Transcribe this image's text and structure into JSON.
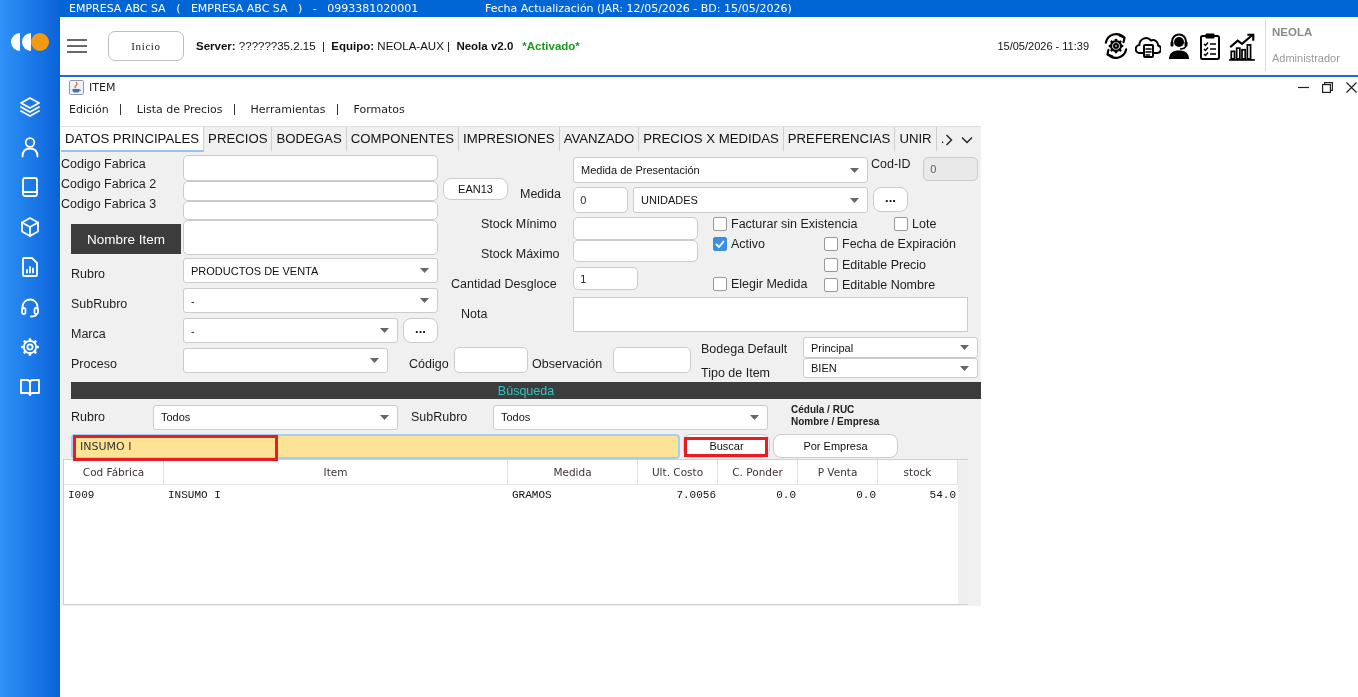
{
  "top_bar": {
    "company": "EMPRESA ABC SA   (   EMPRESA ABC SA   )   -   0993381020001",
    "update_info": "Fecha Actualización (JAR: 12/05/2026 - BD: 15/05/2026)"
  },
  "header": {
    "home_button": "Inicio",
    "connection_info": "**Server:** ??????35.2.15  |  **Equipo:** NEOLA-AUX |  **Neola v2.0**",
    "status": "*Activado*",
    "datetime": "15/05/2026 - 11:39",
    "user": {
      "name": "NEOLA",
      "role": "Administrador"
    }
  },
  "window": {
    "title": "ITEM"
  },
  "menu": [
    "Edición",
    "Lista de Precios",
    "Herramientas",
    "Formatos"
  ],
  "tabs": [
    {
      "label": "DATOS PRINCIPALES",
      "selected": true
    },
    {
      "label": "PRECIOS",
      "selected": false
    },
    {
      "label": "BODEGAS",
      "selected": false
    },
    {
      "label": "COMPONENTES",
      "selected": false
    },
    {
      "label": "IMPRESIONES",
      "selected": false
    },
    {
      "label": "AVANZADO",
      "selected": false
    },
    {
      "label": "PRECIOS X MEDIDAS",
      "selected": false
    },
    {
      "label": "PREFERENCIAS",
      "selected": false
    },
    {
      "label": "UNIR",
      "selected": false
    },
    {
      "label": ".",
      "selected": false
    }
  ],
  "form": {
    "fields": [
      {
        "kind": "label",
        "text": "Codigo Fabrica"
      },
      {
        "kind": "input",
        "disabled": false
      },
      {
        "kind": "label",
        "text": "Codigo Fabrica 2"
      },
      {
        "kind": "input",
        "disabled": false
      },
      {
        "kind": "label",
        "text": "Codigo Fabrica 3"
      },
      {
        "kind": "input",
        "disabled": false
      },
      {
        "kind": "dark_label",
        "text": "Nombre Item"
      },
      {
        "kind": "input",
        "disabled": false
      },
      {
        "kind": "dropdown",
        "value": "Medida de Presentación"
      },
      {
        "kind": "label",
        "text": "Cod-ID"
      },
      {
        "kind": "input",
        "value": "0",
        "disabled": true
      },
      {
        "kind": "button",
        "text": "EAN13"
      },
      {
        "kind": "label",
        "text": "Medida"
      },
      {
        "kind": "input",
        "value": "0",
        "disabled": false
      },
      {
        "kind": "dropdown",
        "value": "UNIDADES"
      },
      {
        "kind": "ellipsis_button",
        "text": "..."
      },
      {
        "kind": "label",
        "text": "Stock Mínimo"
      },
      {
        "kind": "input",
        "disabled": false
      },
      {
        "kind": "checkbox",
        "text": "Facturar sin Existencia",
        "checked": false
      },
      {
        "kind": "checkbox",
        "text": "Lote",
        "checked": false
      },
      {
        "kind": "label",
        "text": "Stock Máximo"
      },
      {
        "kind": "input",
        "disabled": false
      },
      {
        "kind": "checkbox",
        "text": "Activo",
        "checked": true
      },
      {
        "kind": "checkbox",
        "text": "Fecha de Expiración",
        "checked": false
      },
      {
        "kind": "label",
        "text": "Rubro"
      },
      {
        "kind": "dropdown",
        "value": "PRODUCTOS DE VENTA"
      },
      {
        "kind": "checkbox",
        "text": "Editable Precio",
        "checked": false
      },
      {
        "kind": "label",
        "text": "Cantidad Desgloce"
      },
      {
        "kind": "input",
        "value": "1",
        "disabled": false
      },
      {
        "kind": "checkbox",
        "text": "Elegir Medida",
        "checked": false
      },
      {
        "kind": "checkbox",
        "text": "Editable Nombre",
        "checked": false
      },
      {
        "kind": "label",
        "text": "SubRubro"
      },
      {
        "kind": "dropdown",
        "value": "-"
      },
      {
        "kind": "label",
        "text": "Nota"
      },
      {
        "kind": "textarea"
      },
      {
        "kind": "label",
        "text": "Marca"
      },
      {
        "kind": "dropdown",
        "value": "-"
      },
      {
        "kind": "ellipsis_button",
        "text": "..."
      },
      {
        "kind": "label",
        "text": "Proceso"
      },
      {
        "kind": "dropdown"
      },
      {
        "kind": "label",
        "text": "Código"
      },
      {
        "kind": "input",
        "disabled": false
      },
      {
        "kind": "label",
        "text": "Observación"
      },
      {
        "kind": "input",
        "disabled": false
      },
      {
        "kind": "label",
        "text": "Bodega Default"
      },
      {
        "kind": "dropdown",
        "value": "Principal"
      },
      {
        "kind": "label",
        "text": "Tipo de Item"
      },
      {
        "kind": "dropdown",
        "value": "BIEN"
      }
    ]
  },
  "search": {
    "title": "Búsqueda",
    "filters": [
      {
        "label": "Rubro",
        "value": "Todos"
      },
      {
        "label": "SubRubro",
        "value": "Todos"
      }
    ],
    "hint": [
      "Cédula / RUC",
      "Nombre / Empresa"
    ],
    "query": {
      "value": "INSUMO I",
      "highlighted": true
    },
    "buttons": [
      {
        "label": "Buscar",
        "highlighted": true
      },
      {
        "label": "Por Empresa",
        "highlighted": false
      }
    ]
  },
  "table": {
    "columns": [
      "Cod Fábrica",
      "Item",
      "Medida",
      "Ult. Costo",
      "C. Ponder",
      "P Venta",
      "stock"
    ],
    "rows": [
      {
        "cells": [
          "I009",
          "INSUMO I",
          "GRAMOS",
          "7.0056",
          "0.0",
          "0.0",
          "54.0"
        ]
      }
    ]
  }
}
